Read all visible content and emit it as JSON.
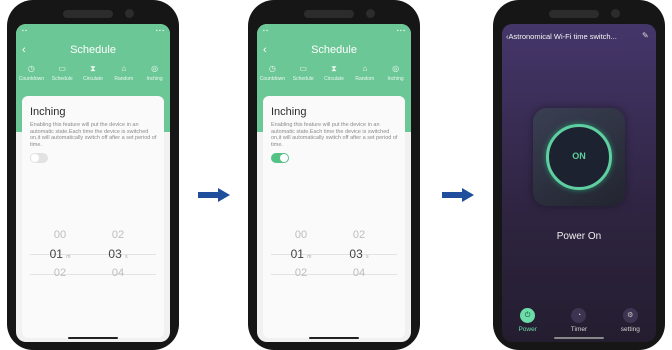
{
  "colors": {
    "header_green": "#6cc796",
    "toggle_on": "#52c285",
    "power_accent": "#5fcfa1",
    "arrow": "#1f4e9c"
  },
  "schedule": {
    "title": "Schedule",
    "back_icon": "chevron-left-icon",
    "tabs": [
      {
        "label": "Countdown",
        "icon": "countdown-icon"
      },
      {
        "label": "Schedule",
        "icon": "calendar-icon"
      },
      {
        "label": "Circulate",
        "icon": "hourglass-icon"
      },
      {
        "label": "Random",
        "icon": "random-icon"
      },
      {
        "label": "Inching",
        "icon": "inching-icon"
      }
    ],
    "card_title": "Inching",
    "description": "Enabling this feature will put the device in an automatic state.Each time the device is switched on,it will automatically switch off after a set period of time.",
    "picker": {
      "minutes": {
        "above": "00",
        "selected": "01",
        "below": "02",
        "unit": "m"
      },
      "seconds": {
        "above": "02",
        "selected": "03",
        "below": "04",
        "unit": "s"
      }
    }
  },
  "phone1": {
    "toggle_on": false
  },
  "phone2": {
    "toggle_on": true
  },
  "device": {
    "title": "Astronomical Wi-Fi time switch...",
    "button_state": "ON",
    "status_text": "Power On",
    "nav": [
      {
        "label": "Power",
        "icon": "power-icon"
      },
      {
        "label": "Timer",
        "icon": "timer-icon"
      },
      {
        "label": "setting",
        "icon": "settings-icon"
      }
    ]
  }
}
